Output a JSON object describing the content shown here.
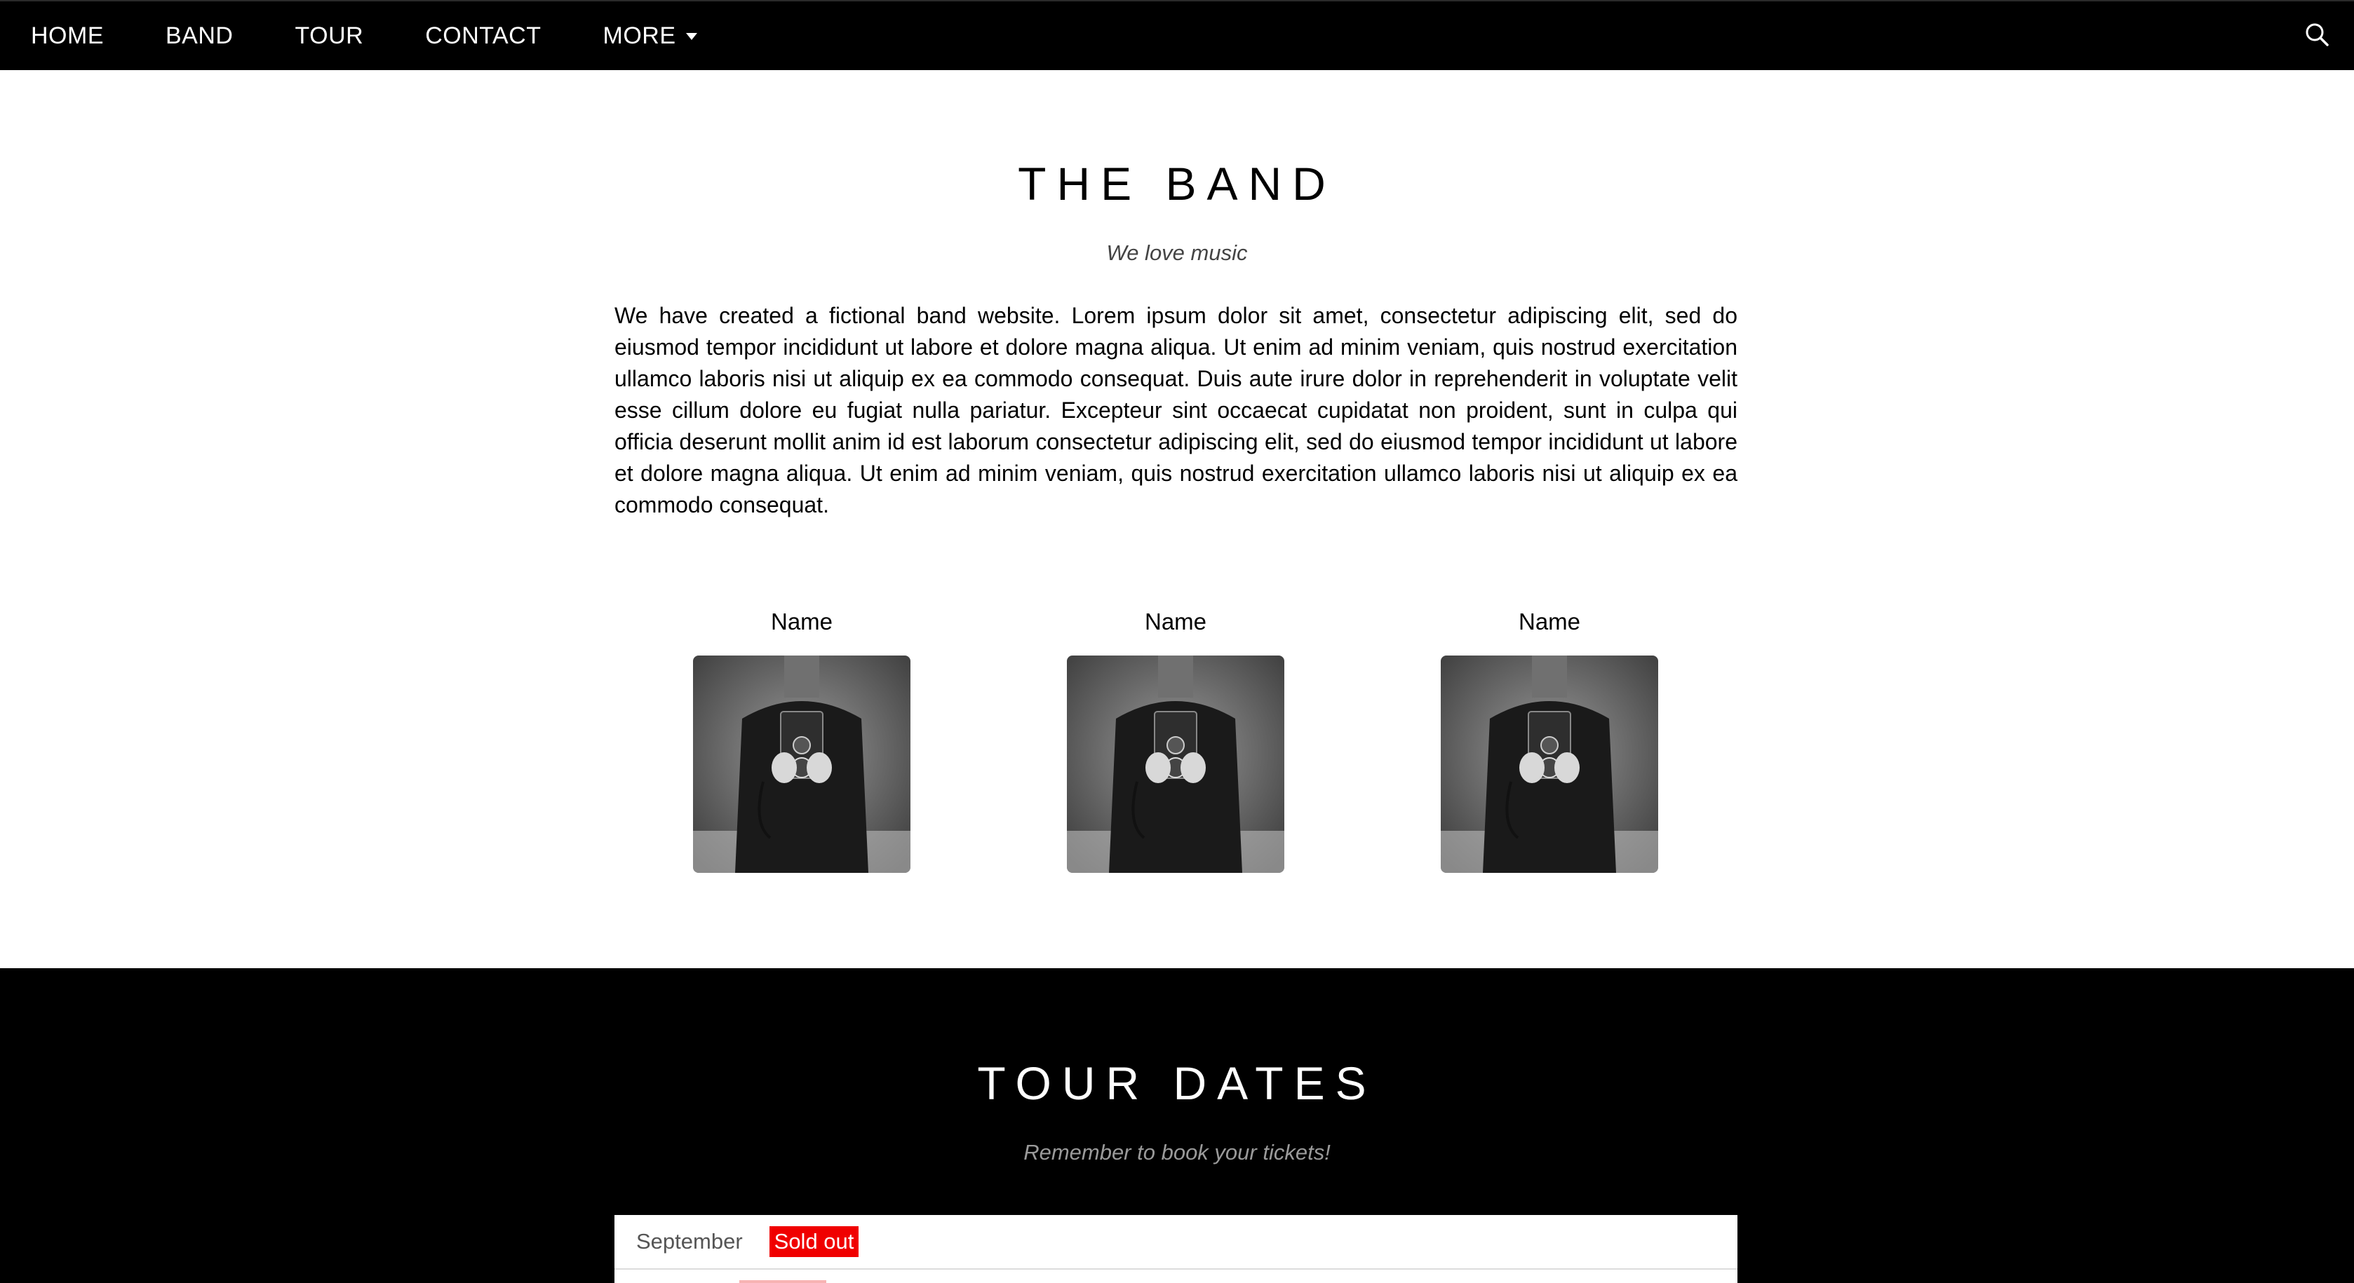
{
  "nav": {
    "items": [
      {
        "label": "HOME"
      },
      {
        "label": "BAND"
      },
      {
        "label": "TOUR"
      },
      {
        "label": "CONTACT"
      },
      {
        "label": "MORE"
      }
    ],
    "search_icon": "search-icon"
  },
  "band": {
    "title": "THE BAND",
    "subtitle": "We love music",
    "description": "We have created a fictional band website. Lorem ipsum dolor sit amet, consectetur adipiscing elit, sed do eiusmod tempor incididunt ut labore et dolore magna aliqua. Ut enim ad minim veniam, quis nostrud exercitation ullamco laboris nisi ut aliquip ex ea commodo consequat. Duis aute irure dolor in reprehenderit in voluptate velit esse cillum dolore eu fugiat nulla pariatur. Excepteur sint occaecat cupidatat non proident, sunt in culpa qui officia deserunt mollit anim id est laborum consectetur adipiscing elit, sed do eiusmod tempor incididunt ut labore et dolore magna aliqua. Ut enim ad minim veniam, quis nostrud exercitation ullamco laboris nisi ut aliquip ex ea commodo consequat.",
    "members": [
      {
        "name": "Name"
      },
      {
        "name": "Name"
      },
      {
        "name": "Name"
      }
    ]
  },
  "tour": {
    "title": "TOUR DATES",
    "subtitle": "Remember to book your tickets!",
    "dates": [
      {
        "month": "September",
        "badge": "Sold out"
      }
    ]
  },
  "colors": {
    "nav_bg": "#000000",
    "badge": "#f00000",
    "tour_bg": "#000000"
  }
}
